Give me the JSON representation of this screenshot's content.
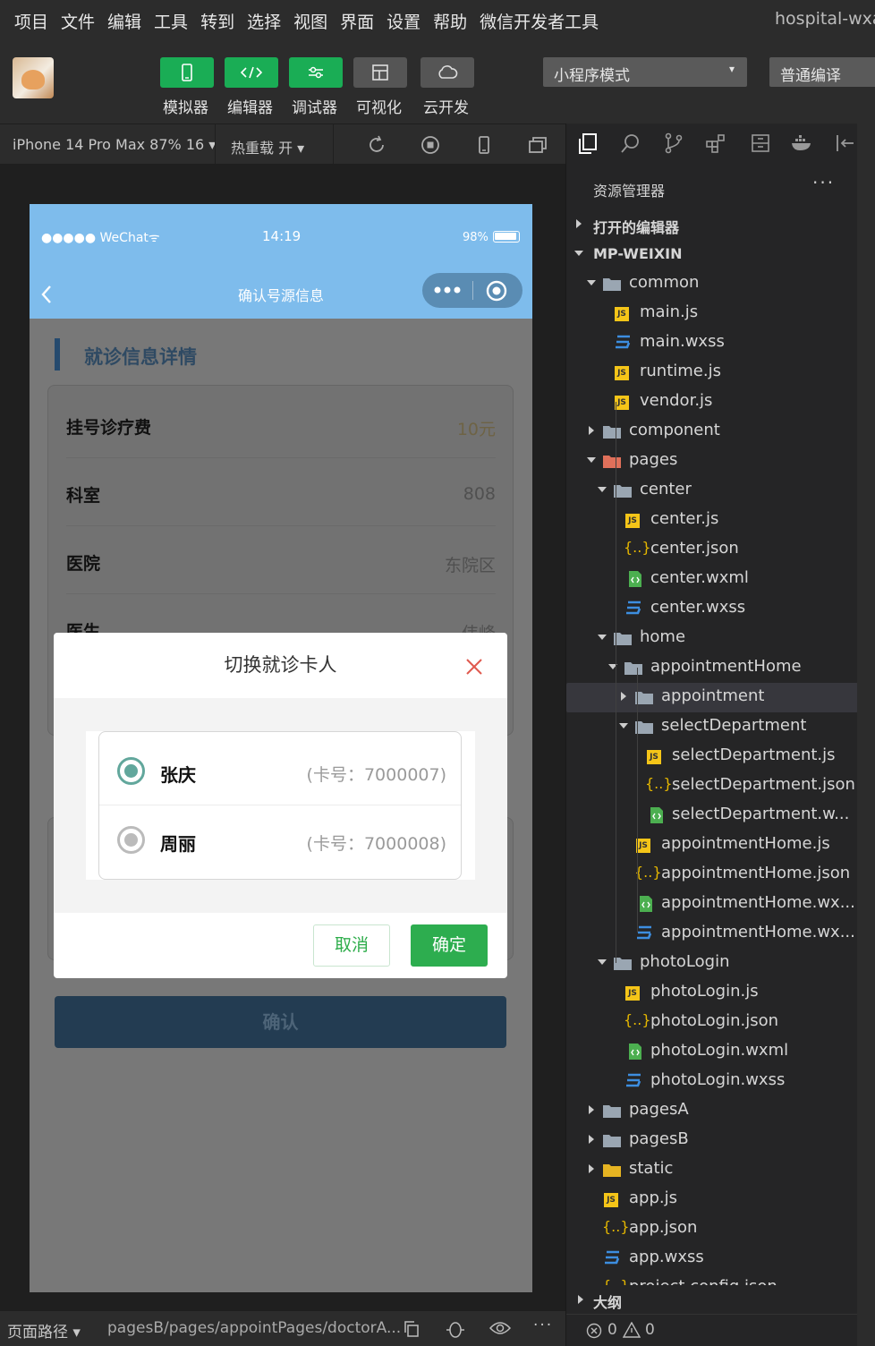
{
  "menu": [
    "项目",
    "文件",
    "编辑",
    "工具",
    "转到",
    "选择",
    "视图",
    "界面",
    "设置",
    "帮助",
    "微信开发者工具"
  ],
  "window_title": "hospital-wxa",
  "toolbar": {
    "buttons": [
      {
        "label": "模拟器",
        "icon": "phone-icon",
        "active": true
      },
      {
        "label": "编辑器",
        "icon": "code-icon",
        "active": true
      },
      {
        "label": "调试器",
        "icon": "debug-icon",
        "active": true
      },
      {
        "label": "可视化",
        "icon": "layout-icon",
        "active": false
      },
      {
        "label": "云开发",
        "icon": "cloud-icon",
        "active": false
      }
    ],
    "mode_select": "小程序模式",
    "compile_select": "普通编译"
  },
  "device_bar": {
    "device": "iPhone 14 Pro Max 87% 16",
    "hot_reload": "热重载 开"
  },
  "phone": {
    "status_left": "●●●●● WeChat",
    "time": "14:19",
    "battery": "98%",
    "nav_title": "确认号源信息",
    "section_title": "就诊信息详情",
    "rows": [
      {
        "key": "挂号诊疗费",
        "value": "10元"
      },
      {
        "key": "科室",
        "value": "808"
      },
      {
        "key": "医院",
        "value": "东院区"
      },
      {
        "key": "医生",
        "value": "伟峰"
      }
    ],
    "confirm_label": "确认"
  },
  "modal": {
    "title": "切换就诊卡人",
    "options": [
      {
        "name": "张庆",
        "card": "(卡号：7000007)",
        "selected": true
      },
      {
        "name": "周丽",
        "card": "(卡号：7000008)",
        "selected": false
      }
    ],
    "cancel": "取消",
    "ok": "确定"
  },
  "bottom": {
    "path_label": "页面路径",
    "path": "pagesB/pages/appointPages/doctorA..."
  },
  "explorer": {
    "title": "资源管理器",
    "open_editors": "打开的编辑器",
    "root": "MP-WEIXIN",
    "tree": [
      {
        "label": "common",
        "type": "folder",
        "open": true
      },
      {
        "label": "main.js",
        "type": "js"
      },
      {
        "label": "main.wxss",
        "type": "wxss"
      },
      {
        "label": "runtime.js",
        "type": "js"
      },
      {
        "label": "vendor.js",
        "type": "js"
      },
      {
        "label": "component",
        "type": "folder",
        "open": false
      },
      {
        "label": "pages",
        "type": "folder-pages",
        "open": true
      },
      {
        "label": "center",
        "type": "folder",
        "open": true
      },
      {
        "label": "center.js",
        "type": "js"
      },
      {
        "label": "center.json",
        "type": "json"
      },
      {
        "label": "center.wxml",
        "type": "wxml"
      },
      {
        "label": "center.wxss",
        "type": "wxss"
      },
      {
        "label": "home",
        "type": "folder",
        "open": true
      },
      {
        "label": "appointmentHome",
        "type": "folder",
        "open": true
      },
      {
        "label": "appointment",
        "type": "folder",
        "open": false,
        "selected": true
      },
      {
        "label": "selectDepartment",
        "type": "folder",
        "open": true
      },
      {
        "label": "selectDepartment.js",
        "type": "js"
      },
      {
        "label": "selectDepartment.json",
        "type": "json"
      },
      {
        "label": "selectDepartment.w...",
        "type": "wxml"
      },
      {
        "label": "appointmentHome.js",
        "type": "js"
      },
      {
        "label": "appointmentHome.json",
        "type": "json"
      },
      {
        "label": "appointmentHome.wx...",
        "type": "wxml"
      },
      {
        "label": "appointmentHome.wx...",
        "type": "wxss"
      },
      {
        "label": "photoLogin",
        "type": "folder",
        "open": true
      },
      {
        "label": "photoLogin.js",
        "type": "js"
      },
      {
        "label": "photoLogin.json",
        "type": "json"
      },
      {
        "label": "photoLogin.wxml",
        "type": "wxml"
      },
      {
        "label": "photoLogin.wxss",
        "type": "wxss"
      },
      {
        "label": "pagesA",
        "type": "folder",
        "open": false
      },
      {
        "label": "pagesB",
        "type": "folder",
        "open": false
      },
      {
        "label": "static",
        "type": "folder-static",
        "open": false
      },
      {
        "label": "app.js",
        "type": "js"
      },
      {
        "label": "app.json",
        "type": "json"
      },
      {
        "label": "app.wxss",
        "type": "wxss"
      },
      {
        "label": "project.config.json",
        "type": "json"
      }
    ],
    "outline": "大纲",
    "errors": "0",
    "warnings": "0"
  }
}
